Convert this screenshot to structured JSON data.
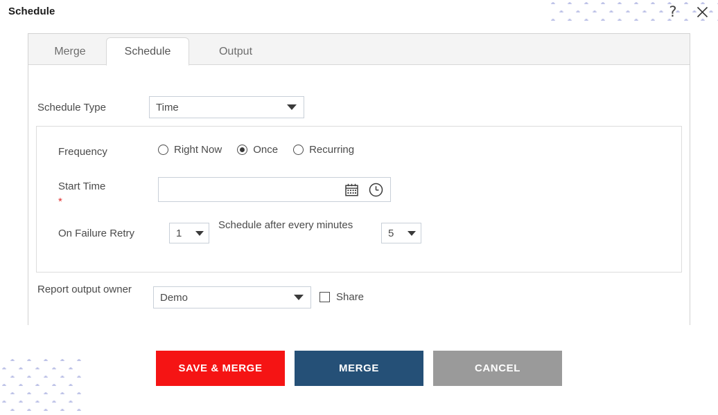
{
  "window": {
    "title": "Schedule",
    "help_icon": "question-mark-icon",
    "close_icon": "close-icon"
  },
  "tabs": [
    {
      "id": "merge",
      "label": "Merge",
      "active": false
    },
    {
      "id": "schedule",
      "label": "Schedule",
      "active": true
    },
    {
      "id": "output",
      "label": "Output",
      "active": false
    }
  ],
  "form": {
    "schedule_type": {
      "label": "Schedule Type",
      "value": "Time"
    },
    "frequency": {
      "label": "Frequency",
      "options": [
        {
          "label": "Right Now",
          "selected": false
        },
        {
          "label": "Once",
          "selected": true
        },
        {
          "label": "Recurring",
          "selected": false
        }
      ]
    },
    "start_time": {
      "label": "Start Time",
      "required_marker": "*",
      "value": "",
      "placeholder": "",
      "calendar_icon": "calendar-icon",
      "clock_icon": "clock-icon"
    },
    "on_failure_retry": {
      "label": "On Failure Retry",
      "count_value": "1",
      "interval_label": "Schedule after every minutes",
      "minutes_value": "5"
    },
    "report_output_owner": {
      "label": "Report output owner",
      "value": "Demo",
      "share_label": "Share",
      "share_checked": false
    }
  },
  "footer": {
    "save_merge_label": "SAVE & MERGE",
    "merge_label": "MERGE",
    "cancel_label": "CANCEL"
  },
  "colors": {
    "save_merge": "#F51414",
    "merge": "#255077",
    "cancel": "#9A9A9A",
    "required": "#E03030",
    "dot_pattern": "#A9B0E0",
    "panel_border": "#D2D2D2",
    "tab_strip_bg": "#F4F4F4"
  }
}
